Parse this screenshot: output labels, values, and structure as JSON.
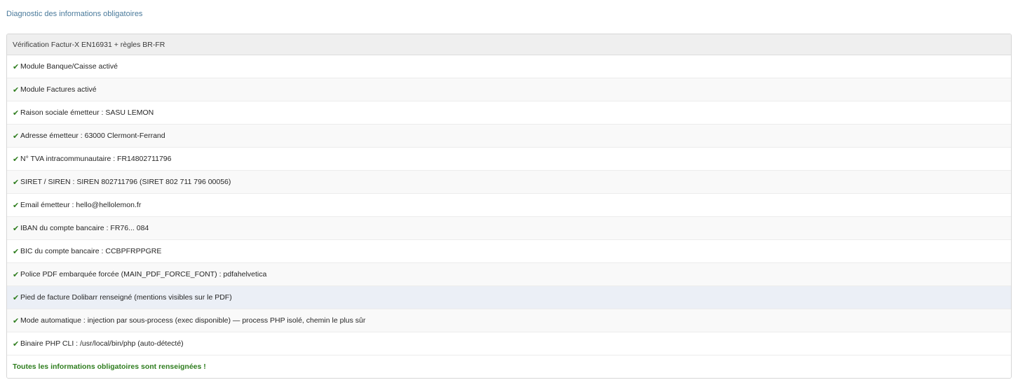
{
  "page": {
    "title": "Diagnostic des informations obligatoires"
  },
  "panel": {
    "header": "Vérification Factur-X EN16931 + règles BR-FR",
    "check_glyph": "✔",
    "rows": [
      {
        "text": "Module Banque/Caisse activé"
      },
      {
        "text": "Module Factures activé"
      },
      {
        "text": "Raison sociale émetteur : SASU LEMON"
      },
      {
        "text": "Adresse émetteur : 63000 Clermont-Ferrand"
      },
      {
        "text": "N° TVA intracommunautaire : FR14802711796"
      },
      {
        "text": "SIRET / SIREN : SIREN 802711796 (SIRET 802 711 796 00056)"
      },
      {
        "text": "Email émetteur : hello@hellolemon.fr"
      },
      {
        "text": "IBAN du compte bancaire : FR76... 084"
      },
      {
        "text": "BIC du compte bancaire : CCBPFRPPGRE"
      },
      {
        "text": "Police PDF embarquée forcée (MAIN_PDF_FORCE_FONT) : pdfahelvetica"
      },
      {
        "text": "Pied de facture Dolibarr renseigné (mentions visibles sur le PDF)"
      },
      {
        "text": "Mode automatique : injection par sous-process (exec disponible) — process PHP isolé, chemin le plus sûr"
      },
      {
        "text": "Binaire PHP CLI : /usr/local/bin/php (auto-détecté)"
      }
    ],
    "summary": "Toutes les informations obligatoires sont renseignées !"
  },
  "colors": {
    "title": "#4a7a9b",
    "check": "#2e7d1e",
    "header_bg": "#efefef",
    "highlight_row_bg": "#ebeff6"
  }
}
